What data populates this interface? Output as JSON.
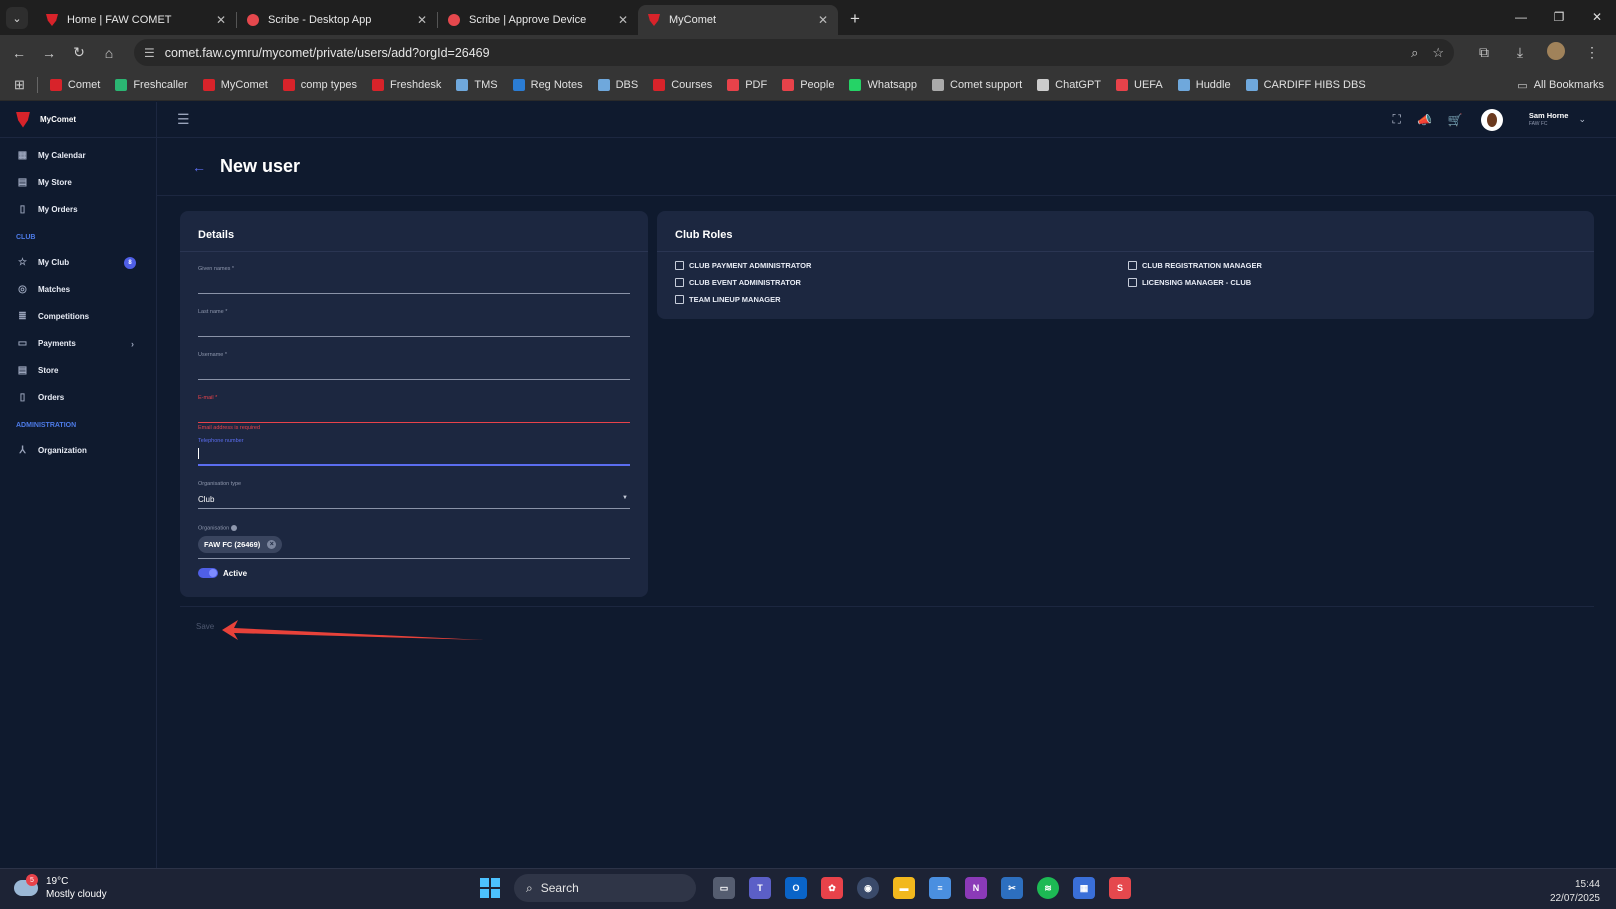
{
  "browser": {
    "tabs": [
      {
        "title": "Home | FAW COMET",
        "favicon": "faw-dragon",
        "active": false
      },
      {
        "title": "Scribe - Desktop App",
        "favicon": "scribe",
        "active": false
      },
      {
        "title": "Scribe | Approve Device",
        "favicon": "scribe",
        "active": false
      },
      {
        "title": "MyComet",
        "favicon": "faw-dragon",
        "active": true
      }
    ],
    "url": "comet.faw.cymru/mycomet/private/users/add?orgId=26469",
    "bookmarks": [
      {
        "label": "Comet",
        "color": "#d8232a"
      },
      {
        "label": "Freshcaller",
        "color": "#2bb673"
      },
      {
        "label": "MyComet",
        "color": "#d8232a"
      },
      {
        "label": "comp types",
        "color": "#d8232a"
      },
      {
        "label": "Freshdesk",
        "color": "#d8232a"
      },
      {
        "label": "TMS",
        "color": "#6fa8dc"
      },
      {
        "label": "Reg Notes",
        "color": "#2b7cd3"
      },
      {
        "label": "DBS",
        "color": "#6fa8dc"
      },
      {
        "label": "Courses",
        "color": "#d8232a"
      },
      {
        "label": "PDF",
        "color": "#e8424a"
      },
      {
        "label": "People",
        "color": "#e8424a"
      },
      {
        "label": "Whatsapp",
        "color": "#25d366"
      },
      {
        "label": "Comet support",
        "color": "#aaaaaa"
      },
      {
        "label": "ChatGPT",
        "color": "#cccccc"
      },
      {
        "label": "UEFA",
        "color": "#e8424a"
      },
      {
        "label": "Huddle",
        "color": "#6fa8dc"
      },
      {
        "label": "CARDIFF HIBS DBS",
        "color": "#6fa8dc"
      }
    ],
    "all_bookmarks": "All Bookmarks"
  },
  "app": {
    "brand": "MyComet",
    "nav": [
      {
        "label": "My Calendar",
        "icon": "calendar-icon"
      },
      {
        "label": "My Store",
        "icon": "store-icon"
      },
      {
        "label": "My Orders",
        "icon": "orders-icon"
      }
    ],
    "club_section": "CLUB",
    "club_nav": [
      {
        "label": "My Club",
        "icon": "star-icon",
        "badge": "8"
      },
      {
        "label": "Matches",
        "icon": "ball-icon"
      },
      {
        "label": "Competitions",
        "icon": "list-icon"
      },
      {
        "label": "Payments",
        "icon": "card-icon"
      },
      {
        "label": "Store",
        "icon": "store-icon"
      },
      {
        "label": "Orders",
        "icon": "orders-icon"
      }
    ],
    "admin_section": "ADMINISTRATION",
    "admin_nav": [
      {
        "label": "Organization",
        "icon": "org-icon"
      }
    ],
    "user": {
      "name": "Sam Horne",
      "club": "FAW FC"
    }
  },
  "page": {
    "title": "New user",
    "details_title": "Details",
    "fields": {
      "given_names": "Given names *",
      "last_name": "Last name *",
      "username": "Username *",
      "email": "E-mail *",
      "email_error": "Email address is required",
      "telephone": "Telephone number",
      "org_type_label": "Organisation type",
      "org_type_value": "Club",
      "org_label": "Organisation",
      "org_chip": "FAW FC (26469)"
    },
    "active_label": "Active",
    "roles_title": "Club Roles",
    "roles": [
      "CLUB PAYMENT ADMINISTRATOR",
      "CLUB EVENT ADMINISTRATOR",
      "TEAM LINEUP MANAGER",
      "CLUB REGISTRATION MANAGER",
      "LICENSING MANAGER - CLUB"
    ],
    "save_label": "Save"
  },
  "taskbar": {
    "temp": "19°C",
    "weather": "Mostly cloudy",
    "weather_badge": "5",
    "search": "Search",
    "time": "15:44",
    "date": "22/07/2025"
  },
  "colors": {
    "accent": "#5b6df0",
    "error": "#e8424a",
    "annotation": "#e8423a"
  }
}
